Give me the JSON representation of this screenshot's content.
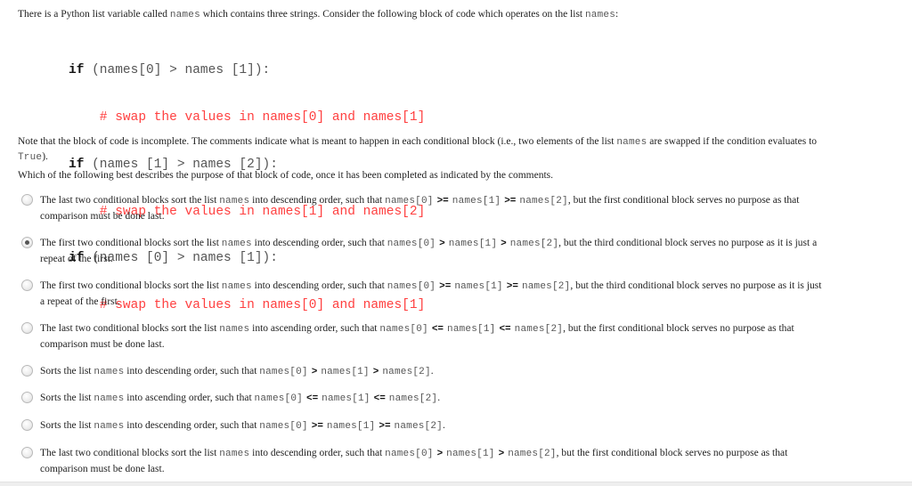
{
  "intro": {
    "before": "There is a Python list variable called ",
    "var": "names",
    "after": " which contains three strings.  Consider the following block of code which operates on the list ",
    "var2": "names",
    "end": ":"
  },
  "code": {
    "lines": [
      {
        "kw": "if",
        "text": " (names[0] > names [1]):",
        "type": "code"
      },
      {
        "text": "    # swap the values in names[0] and names[1]",
        "type": "comment"
      },
      {
        "kw": "if",
        "text": " (names [1] > names [2]):",
        "type": "code"
      },
      {
        "text": "    # swap the values in names[1] and names[2]",
        "type": "comment"
      },
      {
        "kw": "if",
        "text": " (names [0] > names [1]):",
        "type": "code"
      },
      {
        "text": "    # swap the values in names[0] and names[1]",
        "type": "comment"
      }
    ]
  },
  "note": {
    "part1": "Note that the block of code is incomplete.  The comments indicate what is meant to happen in each conditional block (i.e., two elements of the list ",
    "var": "names",
    "part2": "  are swapped if the condition evaluates to ",
    "true_kw": "True",
    "part3": ")."
  },
  "question": "Which of the following best describes the purpose of that block of code, once it has been completed as indicated by the comments.",
  "options": [
    {
      "checked": false,
      "pre": "The last two conditional blocks sort the list ",
      "var": "names",
      "mid": " into descending order, such that ",
      "e0": "names[0]",
      "op1": ">=",
      "e1": "names[1]",
      "op2": ">=",
      "e2": "names[2]",
      "post": ", but the first conditional block serves no purpose as that comparison must be done last."
    },
    {
      "checked": true,
      "pre": "The first two conditional blocks sort the list ",
      "var": "names",
      "mid": " into descending order, such that ",
      "e0": "names[0]",
      "op1": ">",
      "e1": "names[1]",
      "op2": ">",
      "e2": "names[2]",
      "post": ", but the third conditional block serves no purpose as it is just a repeat of the first."
    },
    {
      "checked": false,
      "pre": "The first two conditional blocks sort the list ",
      "var": "names",
      "mid": " into descending order, such that ",
      "e0": "names[0]",
      "op1": ">=",
      "e1": "names[1]",
      "op2": ">=",
      "e2": "names[2]",
      "post": ", but the third conditional block serves no purpose as it is just a repeat of the first."
    },
    {
      "checked": false,
      "pre": "The last two conditional blocks sort the list ",
      "var": "names",
      "mid": " into ascending order, such that ",
      "e0": "names[0]",
      "op1": "<=",
      "e1": "names[1]",
      "op2": "<=",
      "e2": "names[2]",
      "post": ", but the first conditional block serves no purpose as that comparison must be done last."
    },
    {
      "checked": false,
      "pre": "Sorts the list ",
      "var": "names",
      "mid": " into descending order, such that ",
      "e0": "names[0]",
      "op1": ">",
      "e1": "names[1]",
      "op2": ">",
      "e2": "names[2]",
      "post": "."
    },
    {
      "checked": false,
      "pre": "Sorts the list ",
      "var": "names",
      "mid": " into ascending order, such that ",
      "e0": "names[0]",
      "op1": "<=",
      "e1": "names[1]",
      "op2": "<=",
      "e2": "names[2]",
      "post": "."
    },
    {
      "checked": false,
      "pre": "Sorts the list ",
      "var": "names",
      "mid": " into descending order, such that ",
      "e0": "names[0]",
      "op1": ">=",
      "e1": "names[1]",
      "op2": ">=",
      "e2": "names[2]",
      "post": "."
    },
    {
      "checked": false,
      "pre": "The last two conditional blocks sort the list ",
      "var": "names",
      "mid": " into descending order, such that ",
      "e0": "names[0]",
      "op1": ">",
      "e1": "names[1]",
      "op2": ">",
      "e2": "names[2]",
      "post": ", but the first conditional block serves no purpose as that comparison must be done last."
    }
  ],
  "colors": {
    "comment": "#ff4040",
    "code_text": "#555555",
    "body_text": "#222222"
  }
}
